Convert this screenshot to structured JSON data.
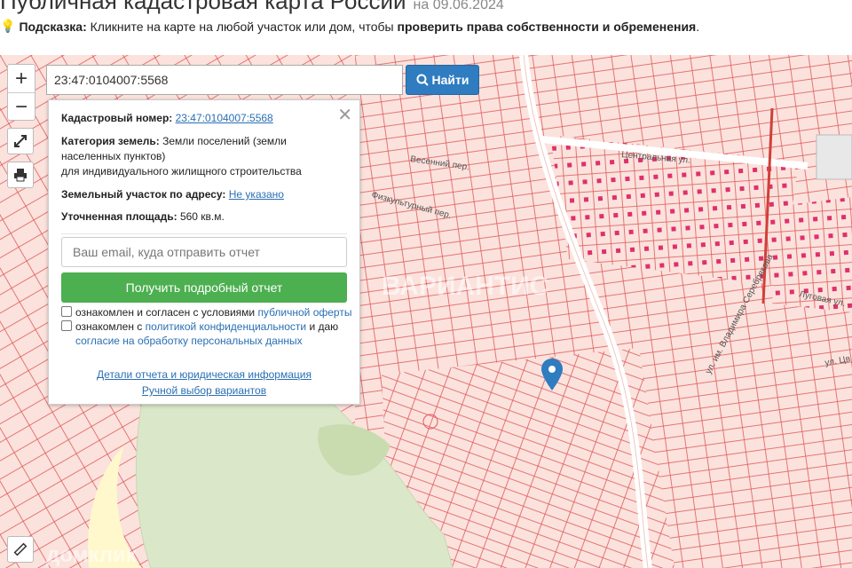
{
  "header": {
    "title": "Публичная кадастровая карта России",
    "date": "на 09.06.2024",
    "hint_prefix": "Подсказка:",
    "hint_text": " Кликните на карте на любой участок или дом, чтобы ",
    "hint_bold": "проверить права собственности и обременения",
    "hint_end": "."
  },
  "search": {
    "value": "23:47:0104007:5568",
    "button_label": "Найти"
  },
  "controls": {
    "zoom_in": "+",
    "zoom_out": "−"
  },
  "panel": {
    "cadastral_label": "Кадастровый номер:",
    "cadastral_value": "23:47:0104007:5568",
    "category_label": "Категория земель:",
    "category_value_1": "Земли поселений (земли",
    "category_value_2": "населенных пунктов)",
    "category_value_3": "для индивидуального жилищного строительства",
    "address_label": "Земельный участок по адресу:",
    "address_value": "Не указано",
    "area_label": "Уточненная площадь:",
    "area_value": "560 кв.м.",
    "email_placeholder": "Ваш email, куда отправить отчет",
    "report_button": "Получить подробный отчет",
    "consent1_text": "ознакомлен и согласен с условиями ",
    "consent1_link": "публичной оферты",
    "consent2_text": "ознакомлен с ",
    "consent2_link": "политикой конфиденциальности",
    "consent2_mid": " и даю",
    "consent2_link2": "согласие на обработку персональных данных",
    "details_link": "Детали отчета и юридическая информация",
    "manual_link": "Ручной выбор вариантов"
  },
  "map": {
    "streets": [
      "Весенний пер.",
      "Центральная ул.",
      "Физкультурный пер.",
      "Луговая ул.",
      "ул. им. Владимира Серебрякова",
      "ул. Цв"
    ],
    "watermark_bottom": "домклик",
    "watermark_mid": "ВАРИАНТИС",
    "parcel_line_color": "#e05050",
    "parcel_fill_color": "#fde8e4",
    "green_area_color": "#dbe7c9",
    "marker_color": "#2f7cc0"
  }
}
